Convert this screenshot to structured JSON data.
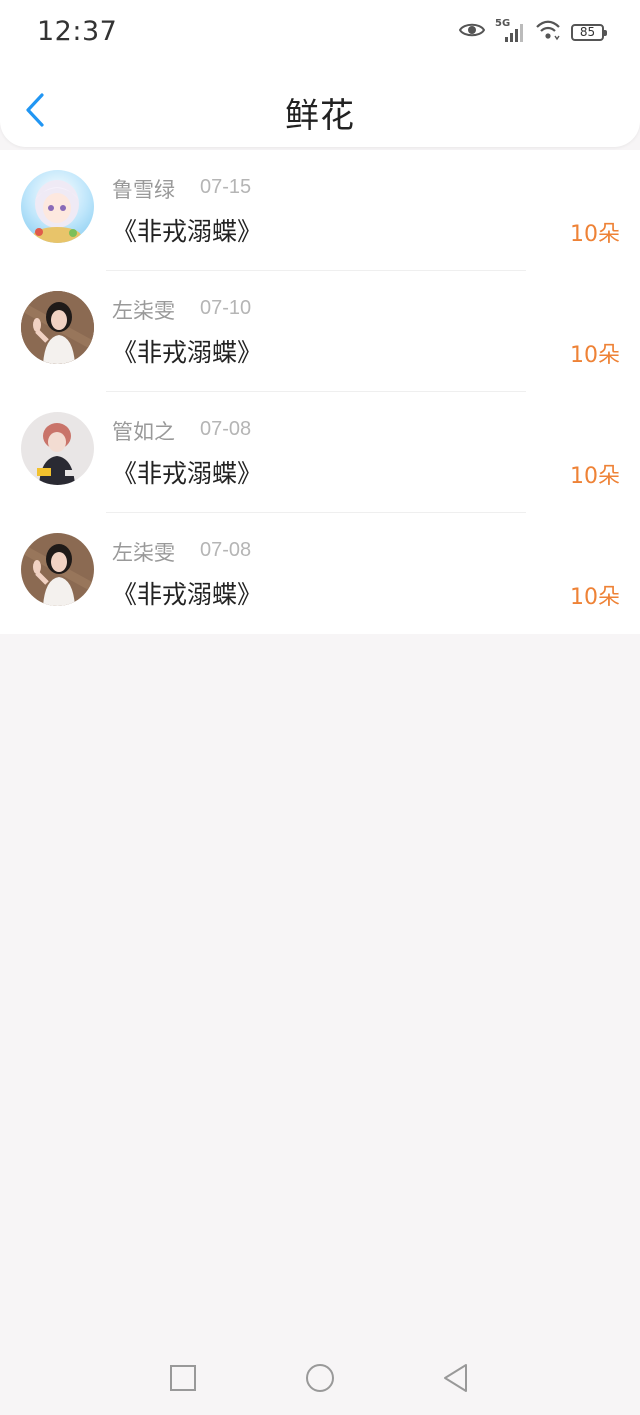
{
  "status_bar": {
    "time": "12:37",
    "network": "5G",
    "battery": "85",
    "icons": [
      "eye-icon",
      "signal-icon",
      "wifi-icon",
      "battery-icon"
    ]
  },
  "header": {
    "title": "鲜花",
    "back_icon": "chevron-left-icon",
    "accent_color": "#2196f3"
  },
  "records": [
    {
      "name": "鲁雪绿",
      "date": "07-15",
      "title": "《非戎溺蝶》",
      "amount": "10朵",
      "avatar": "anime-girl-avatar"
    },
    {
      "name": "左柒雯",
      "date": "07-10",
      "title": "《非戎溺蝶》",
      "amount": "10朵",
      "avatar": "girl-photo-avatar"
    },
    {
      "name": "管如之",
      "date": "07-08",
      "title": "《非戎溺蝶》",
      "amount": "10朵",
      "avatar": "person-photo-avatar"
    },
    {
      "name": "左柒雯",
      "date": "07-08",
      "title": "《非戎溺蝶》",
      "amount": "10朵",
      "avatar": "girl-photo-avatar"
    }
  ],
  "colors": {
    "amount": "#ee8236",
    "name": "#999999",
    "background": "#f7f5f6"
  },
  "nav_bar": {
    "buttons": [
      "recents-square-icon",
      "home-circle-icon",
      "back-triangle-icon"
    ]
  }
}
